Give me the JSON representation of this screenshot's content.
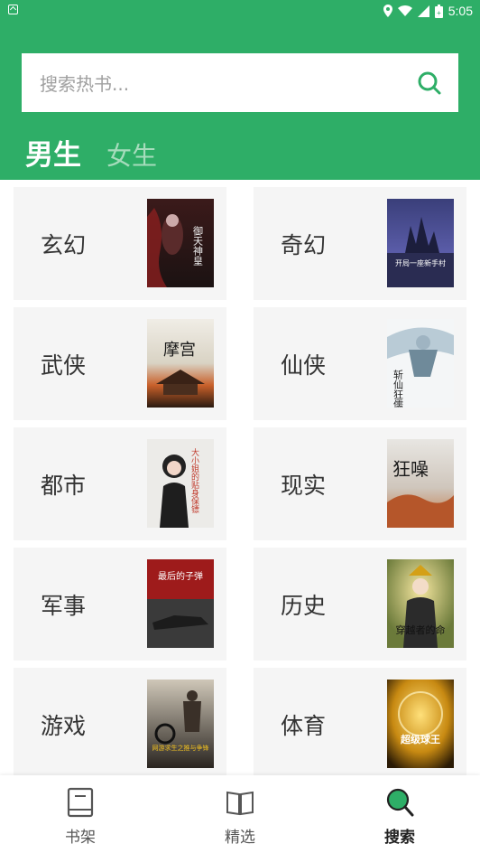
{
  "status_bar": {
    "time": "5:05"
  },
  "search": {
    "placeholder": "搜索热书..."
  },
  "tabs": [
    {
      "label": "男生",
      "active": true
    },
    {
      "label": "女生",
      "active": false
    }
  ],
  "categories": [
    {
      "label": "玄幻",
      "cover_title": "御天神皇"
    },
    {
      "label": "奇幻",
      "cover_title": "开局一座新手村"
    },
    {
      "label": "武侠",
      "cover_title": "摩宫"
    },
    {
      "label": "仙侠",
      "cover_title": "斩仙狂儒"
    },
    {
      "label": "都市",
      "cover_title": "大小姐的贴身保镖"
    },
    {
      "label": "现实",
      "cover_title": "狂噪"
    },
    {
      "label": "军事",
      "cover_title": "最后的子弹"
    },
    {
      "label": "历史",
      "cover_title": "穿越者的命"
    },
    {
      "label": "游戏",
      "cover_title": "网游求生之推与争锋"
    },
    {
      "label": "体育",
      "cover_title": "超级球王"
    }
  ],
  "bottom_nav": [
    {
      "label": "书架",
      "icon": "book-icon",
      "active": false
    },
    {
      "label": "精选",
      "icon": "open-book-icon",
      "active": false
    },
    {
      "label": "搜索",
      "icon": "search-icon",
      "active": true
    }
  ],
  "colors": {
    "brand": "#2eae67",
    "card_bg": "#f5f5f5"
  }
}
